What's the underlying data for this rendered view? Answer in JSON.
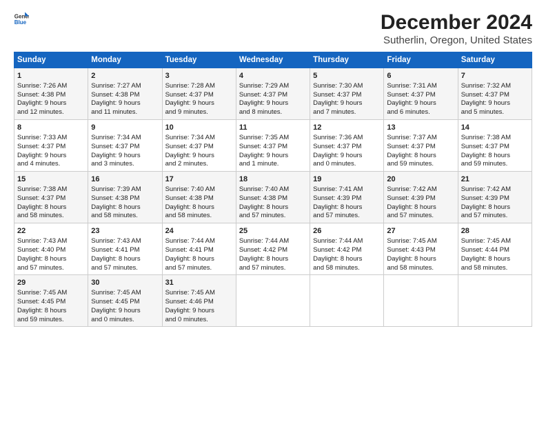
{
  "header": {
    "logo_line1": "General",
    "logo_line2": "Blue",
    "main_title": "December 2024",
    "subtitle": "Sutherlin, Oregon, United States"
  },
  "columns": [
    "Sunday",
    "Monday",
    "Tuesday",
    "Wednesday",
    "Thursday",
    "Friday",
    "Saturday"
  ],
  "rows": [
    [
      {
        "day": "1",
        "lines": [
          "Sunrise: 7:26 AM",
          "Sunset: 4:38 PM",
          "Daylight: 9 hours",
          "and 12 minutes."
        ]
      },
      {
        "day": "2",
        "lines": [
          "Sunrise: 7:27 AM",
          "Sunset: 4:38 PM",
          "Daylight: 9 hours",
          "and 11 minutes."
        ]
      },
      {
        "day": "3",
        "lines": [
          "Sunrise: 7:28 AM",
          "Sunset: 4:37 PM",
          "Daylight: 9 hours",
          "and 9 minutes."
        ]
      },
      {
        "day": "4",
        "lines": [
          "Sunrise: 7:29 AM",
          "Sunset: 4:37 PM",
          "Daylight: 9 hours",
          "and 8 minutes."
        ]
      },
      {
        "day": "5",
        "lines": [
          "Sunrise: 7:30 AM",
          "Sunset: 4:37 PM",
          "Daylight: 9 hours",
          "and 7 minutes."
        ]
      },
      {
        "day": "6",
        "lines": [
          "Sunrise: 7:31 AM",
          "Sunset: 4:37 PM",
          "Daylight: 9 hours",
          "and 6 minutes."
        ]
      },
      {
        "day": "7",
        "lines": [
          "Sunrise: 7:32 AM",
          "Sunset: 4:37 PM",
          "Daylight: 9 hours",
          "and 5 minutes."
        ]
      }
    ],
    [
      {
        "day": "8",
        "lines": [
          "Sunrise: 7:33 AM",
          "Sunset: 4:37 PM",
          "Daylight: 9 hours",
          "and 4 minutes."
        ]
      },
      {
        "day": "9",
        "lines": [
          "Sunrise: 7:34 AM",
          "Sunset: 4:37 PM",
          "Daylight: 9 hours",
          "and 3 minutes."
        ]
      },
      {
        "day": "10",
        "lines": [
          "Sunrise: 7:34 AM",
          "Sunset: 4:37 PM",
          "Daylight: 9 hours",
          "and 2 minutes."
        ]
      },
      {
        "day": "11",
        "lines": [
          "Sunrise: 7:35 AM",
          "Sunset: 4:37 PM",
          "Daylight: 9 hours",
          "and 1 minute."
        ]
      },
      {
        "day": "12",
        "lines": [
          "Sunrise: 7:36 AM",
          "Sunset: 4:37 PM",
          "Daylight: 9 hours",
          "and 0 minutes."
        ]
      },
      {
        "day": "13",
        "lines": [
          "Sunrise: 7:37 AM",
          "Sunset: 4:37 PM",
          "Daylight: 8 hours",
          "and 59 minutes."
        ]
      },
      {
        "day": "14",
        "lines": [
          "Sunrise: 7:38 AM",
          "Sunset: 4:37 PM",
          "Daylight: 8 hours",
          "and 59 minutes."
        ]
      }
    ],
    [
      {
        "day": "15",
        "lines": [
          "Sunrise: 7:38 AM",
          "Sunset: 4:37 PM",
          "Daylight: 8 hours",
          "and 58 minutes."
        ]
      },
      {
        "day": "16",
        "lines": [
          "Sunrise: 7:39 AM",
          "Sunset: 4:38 PM",
          "Daylight: 8 hours",
          "and 58 minutes."
        ]
      },
      {
        "day": "17",
        "lines": [
          "Sunrise: 7:40 AM",
          "Sunset: 4:38 PM",
          "Daylight: 8 hours",
          "and 58 minutes."
        ]
      },
      {
        "day": "18",
        "lines": [
          "Sunrise: 7:40 AM",
          "Sunset: 4:38 PM",
          "Daylight: 8 hours",
          "and 57 minutes."
        ]
      },
      {
        "day": "19",
        "lines": [
          "Sunrise: 7:41 AM",
          "Sunset: 4:39 PM",
          "Daylight: 8 hours",
          "and 57 minutes."
        ]
      },
      {
        "day": "20",
        "lines": [
          "Sunrise: 7:42 AM",
          "Sunset: 4:39 PM",
          "Daylight: 8 hours",
          "and 57 minutes."
        ]
      },
      {
        "day": "21",
        "lines": [
          "Sunrise: 7:42 AM",
          "Sunset: 4:39 PM",
          "Daylight: 8 hours",
          "and 57 minutes."
        ]
      }
    ],
    [
      {
        "day": "22",
        "lines": [
          "Sunrise: 7:43 AM",
          "Sunset: 4:40 PM",
          "Daylight: 8 hours",
          "and 57 minutes."
        ]
      },
      {
        "day": "23",
        "lines": [
          "Sunrise: 7:43 AM",
          "Sunset: 4:41 PM",
          "Daylight: 8 hours",
          "and 57 minutes."
        ]
      },
      {
        "day": "24",
        "lines": [
          "Sunrise: 7:44 AM",
          "Sunset: 4:41 PM",
          "Daylight: 8 hours",
          "and 57 minutes."
        ]
      },
      {
        "day": "25",
        "lines": [
          "Sunrise: 7:44 AM",
          "Sunset: 4:42 PM",
          "Daylight: 8 hours",
          "and 57 minutes."
        ]
      },
      {
        "day": "26",
        "lines": [
          "Sunrise: 7:44 AM",
          "Sunset: 4:42 PM",
          "Daylight: 8 hours",
          "and 58 minutes."
        ]
      },
      {
        "day": "27",
        "lines": [
          "Sunrise: 7:45 AM",
          "Sunset: 4:43 PM",
          "Daylight: 8 hours",
          "and 58 minutes."
        ]
      },
      {
        "day": "28",
        "lines": [
          "Sunrise: 7:45 AM",
          "Sunset: 4:44 PM",
          "Daylight: 8 hours",
          "and 58 minutes."
        ]
      }
    ],
    [
      {
        "day": "29",
        "lines": [
          "Sunrise: 7:45 AM",
          "Sunset: 4:45 PM",
          "Daylight: 8 hours",
          "and 59 minutes."
        ]
      },
      {
        "day": "30",
        "lines": [
          "Sunrise: 7:45 AM",
          "Sunset: 4:45 PM",
          "Daylight: 9 hours",
          "and 0 minutes."
        ]
      },
      {
        "day": "31",
        "lines": [
          "Sunrise: 7:45 AM",
          "Sunset: 4:46 PM",
          "Daylight: 9 hours",
          "and 0 minutes."
        ]
      },
      null,
      null,
      null,
      null
    ]
  ]
}
